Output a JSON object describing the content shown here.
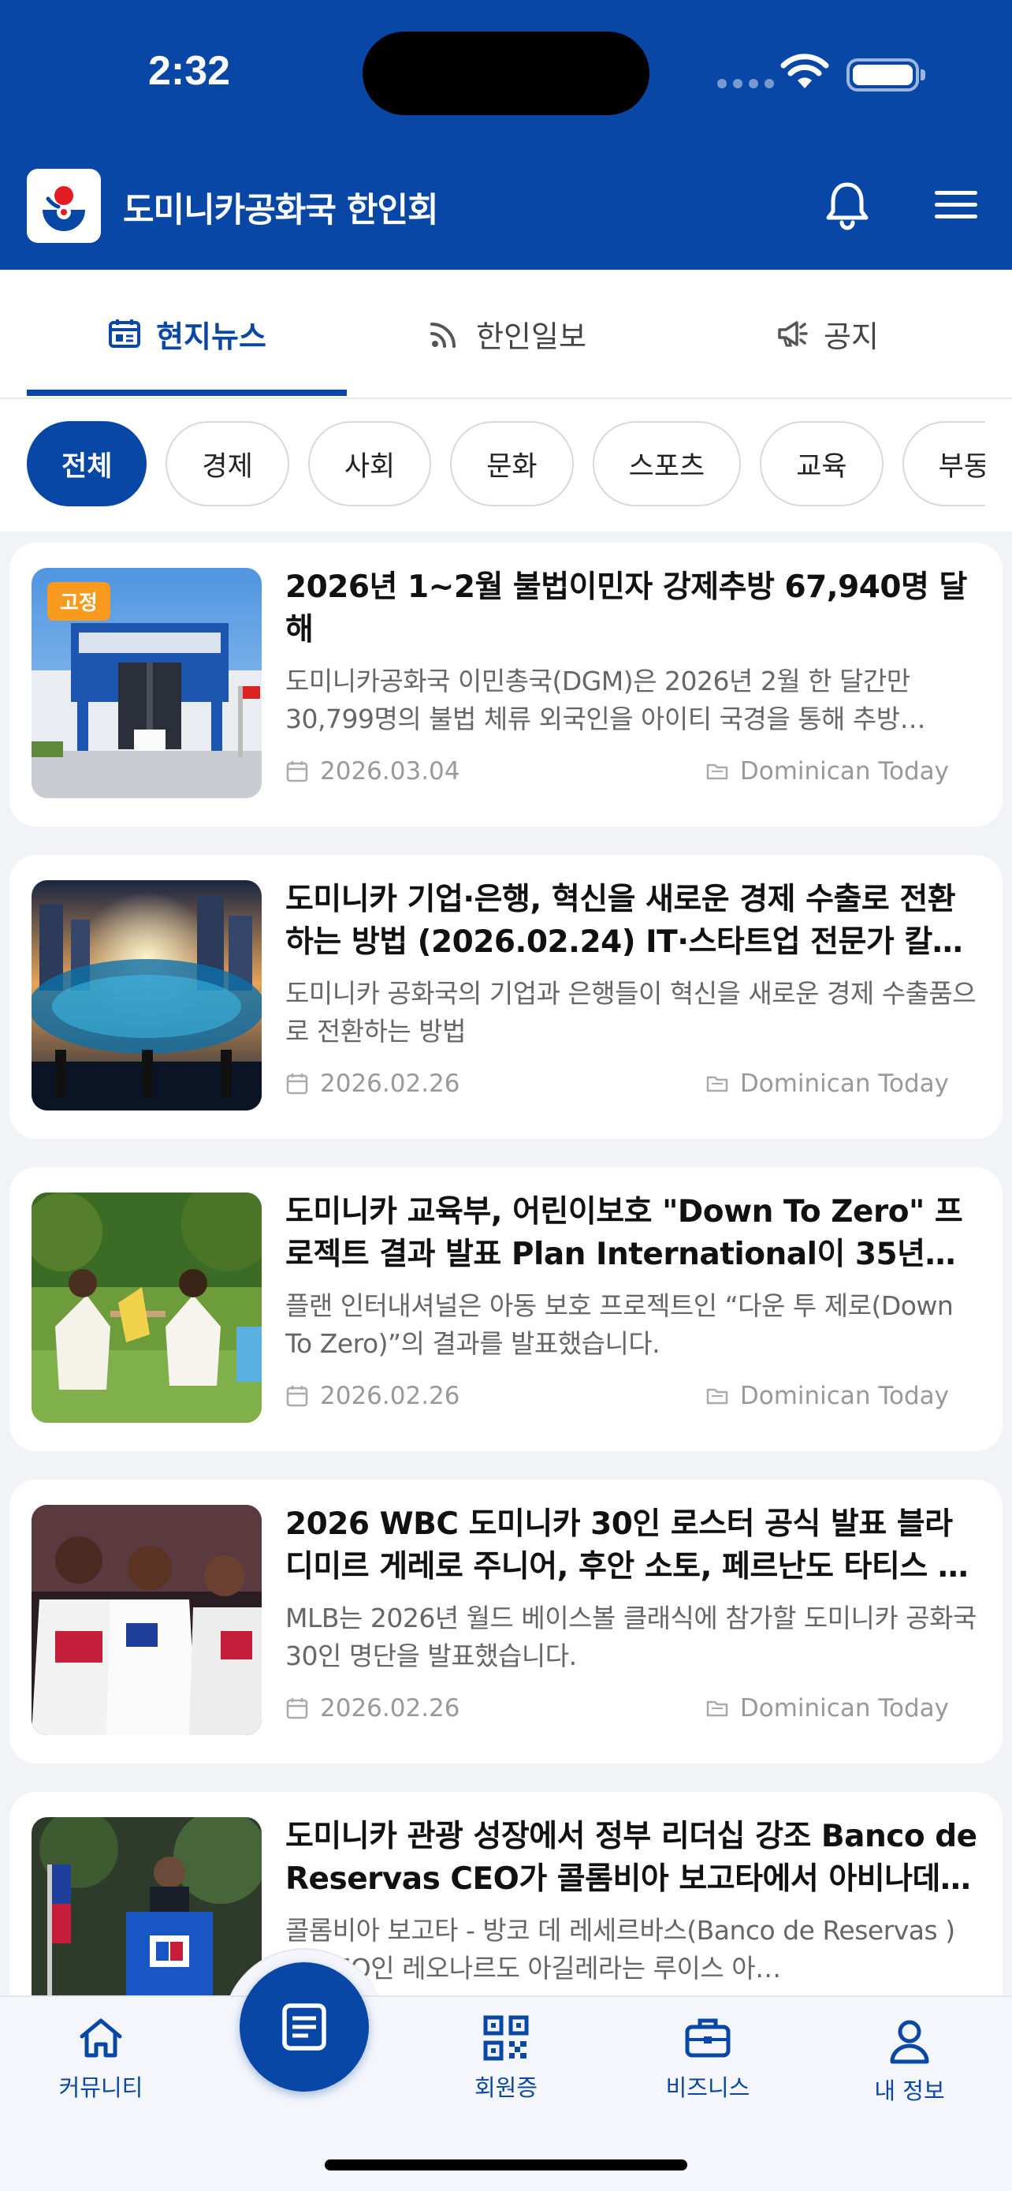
{
  "status_bar": {
    "time": "2:32"
  },
  "app": {
    "title": "도미니카공화국 한인회"
  },
  "colors": {
    "brand": "#0847a6",
    "badge": "#f79a1e"
  },
  "header": {
    "icons": [
      "bell-icon",
      "menu-icon"
    ]
  },
  "main_tabs": [
    {
      "label": "현지뉴스",
      "icon": "calendar-news-icon",
      "active": true
    },
    {
      "label": "한인일보",
      "icon": "rss-icon",
      "active": false
    },
    {
      "label": "공지",
      "icon": "megaphone-icon",
      "active": false
    }
  ],
  "chips": [
    {
      "label": "전체",
      "active": true
    },
    {
      "label": "경제"
    },
    {
      "label": "사회"
    },
    {
      "label": "문화"
    },
    {
      "label": "스포츠"
    },
    {
      "label": "교육"
    },
    {
      "label": "부동"
    }
  ],
  "news": [
    {
      "badge": "고정",
      "title": "2026년 1~2월 불법이민자 강제추방 67,940명 달해",
      "summary": "도미니카공화국 이민총국(DGM)은 2026년 2월 한 달간만 30,799명의 불법 체류 외국인을 아이티 국경을 통해 추방…",
      "date": "2026.03.04",
      "source": "Dominican Today"
    },
    {
      "title": "도미니카 기업·은행, 혁신을 새로운 경제 수출로 전환하는 방법 (2026.02.24) IT·스타트업 전문가 칼…",
      "summary": "도미니카 공화국의 기업과 은행들이 혁신을 새로운 경제 수출품으로 전환하는 방법",
      "date": "2026.02.26",
      "source": "Dominican Today"
    },
    {
      "title": "도미니카 교육부, 어린이보호 \"Down To Zero\" 프로젝트 결과 발표 Plan International이 35년간…",
      "summary": "플랜 인터내셔널은 아동 보호 프로젝트인 “다운 투 제로(Down To Zero)”의 결과를 발표했습니다.",
      "date": "2026.02.26",
      "source": "Dominican Today"
    },
    {
      "title": "2026 WBC 도미니카 30인 로스터 공식 발표 블라디미르 게레로 주니어, 후안 소토, 페르난도 타티스 …",
      "summary": "MLB는 2026년 월드 베이스볼 클래식에 참가할 도미니카 공화국 30인 명단을 발표했습니다.",
      "date": "2026.02.26",
      "source": "Dominican Today"
    },
    {
      "title": "도미니카 관광 성장에서 정부 리더십 강조 Banco de Reservas CEO가 콜롬비아 보고타에서 아비나데…",
      "summary": "콜롬비아 보고타 - 방코 데 레세르바스(Banco de Reservas ) 의 CEO인 레오나르도 아길레라는 루이스 아…",
      "date": "",
      "source": ""
    }
  ],
  "bottom_nav": [
    {
      "label": "커뮤니티",
      "icon": "home-icon"
    },
    {
      "label": "",
      "icon": "document-icon"
    },
    {
      "label": "회원증",
      "icon": "qr-code-icon"
    },
    {
      "label": "비즈니스",
      "icon": "briefcase-icon"
    },
    {
      "label": "내 정보",
      "icon": "user-icon"
    }
  ]
}
